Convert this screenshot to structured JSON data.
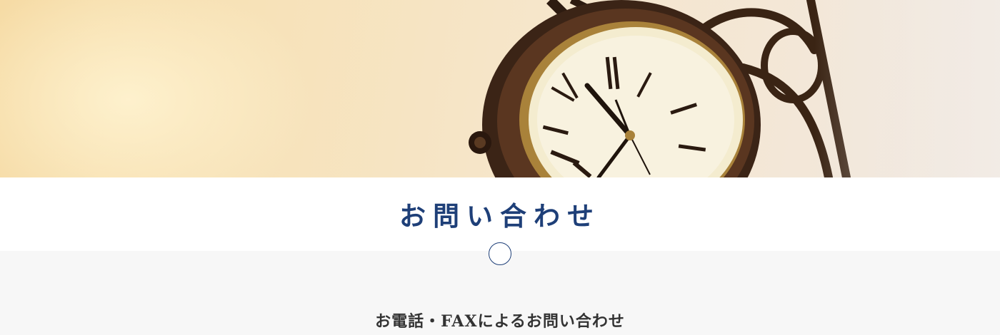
{
  "hero": {
    "image_icon": "wall-clock-photo"
  },
  "page": {
    "title": "お問い合わせ",
    "accent_color": "#1e3f78"
  },
  "section": {
    "marker_icon": "circle-icon",
    "heading": "お電話・FAXによるお問い合わせ"
  }
}
